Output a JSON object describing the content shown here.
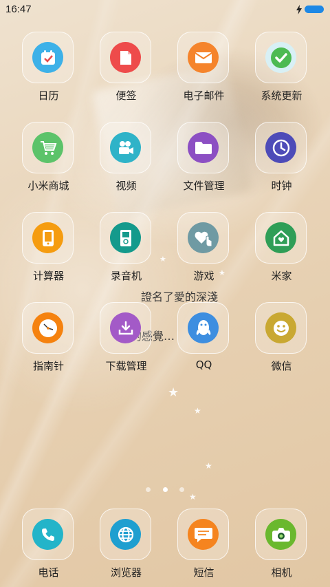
{
  "status_bar": {
    "time": "16:47",
    "charging_icon": "bolt-icon",
    "battery_icon": "battery-icon"
  },
  "wallpaper": {
    "caption_line1": "證名了愛的深淺",
    "caption_line2": "的感覺…"
  },
  "apps": [
    {
      "label": "日历",
      "icon": "calendar-icon",
      "color": "#3db1e8"
    },
    {
      "label": "便签",
      "icon": "note-icon",
      "color": "#ee4b4b"
    },
    {
      "label": "电子邮件",
      "icon": "mail-icon",
      "color": "#f5842c"
    },
    {
      "label": "系统更新",
      "icon": "update-check-icon",
      "color": "#4dba52"
    },
    {
      "label": "小米商城",
      "icon": "shopping-cart-icon",
      "color": "#5cc36a"
    },
    {
      "label": "视频",
      "icon": "video-camera-icon",
      "color": "#2fb3c8"
    },
    {
      "label": "文件管理",
      "icon": "folder-icon",
      "color": "#8c4fc3"
    },
    {
      "label": "时钟",
      "icon": "clock-icon",
      "color": "#4d4bb8"
    },
    {
      "label": "计算器",
      "icon": "calculator-icon",
      "color": "#f59c10"
    },
    {
      "label": "录音机",
      "icon": "recorder-icon",
      "color": "#149a8c"
    },
    {
      "label": "游戏",
      "icon": "game-heart-icon",
      "color": "#6f9aa3"
    },
    {
      "label": "米家",
      "icon": "home-icon",
      "color": "#2f9e57"
    },
    {
      "label": "指南针",
      "icon": "compass-icon",
      "color": "#f5820f"
    },
    {
      "label": "下载管理",
      "icon": "download-icon",
      "color": "#a35ac7"
    },
    {
      "label": "QQ",
      "icon": "qq-penguin-icon",
      "color": "#3d8ee0"
    },
    {
      "label": "微信",
      "icon": "smiley-icon",
      "color": "#c9a832"
    }
  ],
  "page_indicator": {
    "pages": 3,
    "active": 2
  },
  "dock": [
    {
      "label": "电话",
      "icon": "phone-icon",
      "color": "#23b4c9"
    },
    {
      "label": "浏览器",
      "icon": "globe-icon",
      "color": "#1f9fd0"
    },
    {
      "label": "短信",
      "icon": "message-icon",
      "color": "#f5841f"
    },
    {
      "label": "相机",
      "icon": "camera-icon",
      "color": "#6ab82e"
    }
  ]
}
